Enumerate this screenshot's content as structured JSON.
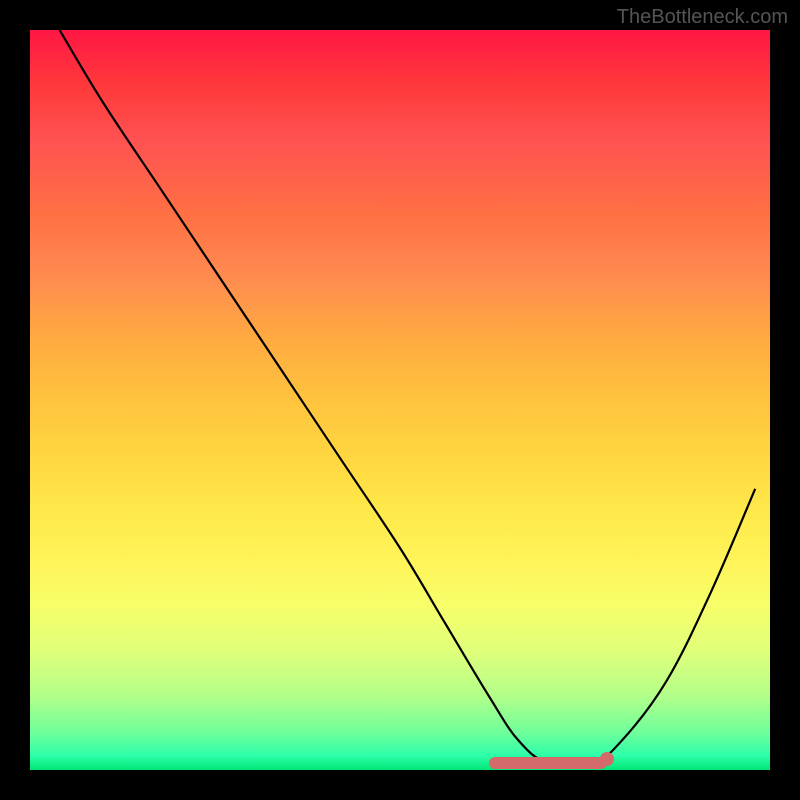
{
  "watermark": "TheBottleneck.com",
  "chart_data": {
    "type": "line",
    "title": "",
    "xlabel": "",
    "ylabel": "",
    "xlim": [
      0,
      100
    ],
    "ylim": [
      0,
      100
    ],
    "grid": false,
    "legend": false,
    "series": [
      {
        "name": "curve",
        "x": [
          4,
          10,
          18,
          26,
          34,
          42,
          50,
          56,
          62,
          66,
          70,
          76,
          80,
          86,
          92,
          98
        ],
        "y": [
          100,
          90,
          78,
          66,
          54,
          42,
          30,
          20,
          10,
          4,
          1,
          1,
          4,
          12,
          24,
          38
        ],
        "color": "#000000"
      }
    ],
    "annotations": [
      {
        "type": "band",
        "x_start": 62,
        "x_end": 78,
        "y": 1,
        "color": "#d46a6a"
      },
      {
        "type": "dot",
        "x": 78,
        "y": 1.5,
        "color": "#d46a6a"
      }
    ],
    "background_gradient": {
      "direction": "vertical",
      "stops": [
        {
          "pos": 0.0,
          "color": "#ff1744"
        },
        {
          "pos": 0.5,
          "color": "#ffd740"
        },
        {
          "pos": 0.85,
          "color": "#d4ff7a"
        },
        {
          "pos": 1.0,
          "color": "#00e676"
        }
      ]
    }
  }
}
